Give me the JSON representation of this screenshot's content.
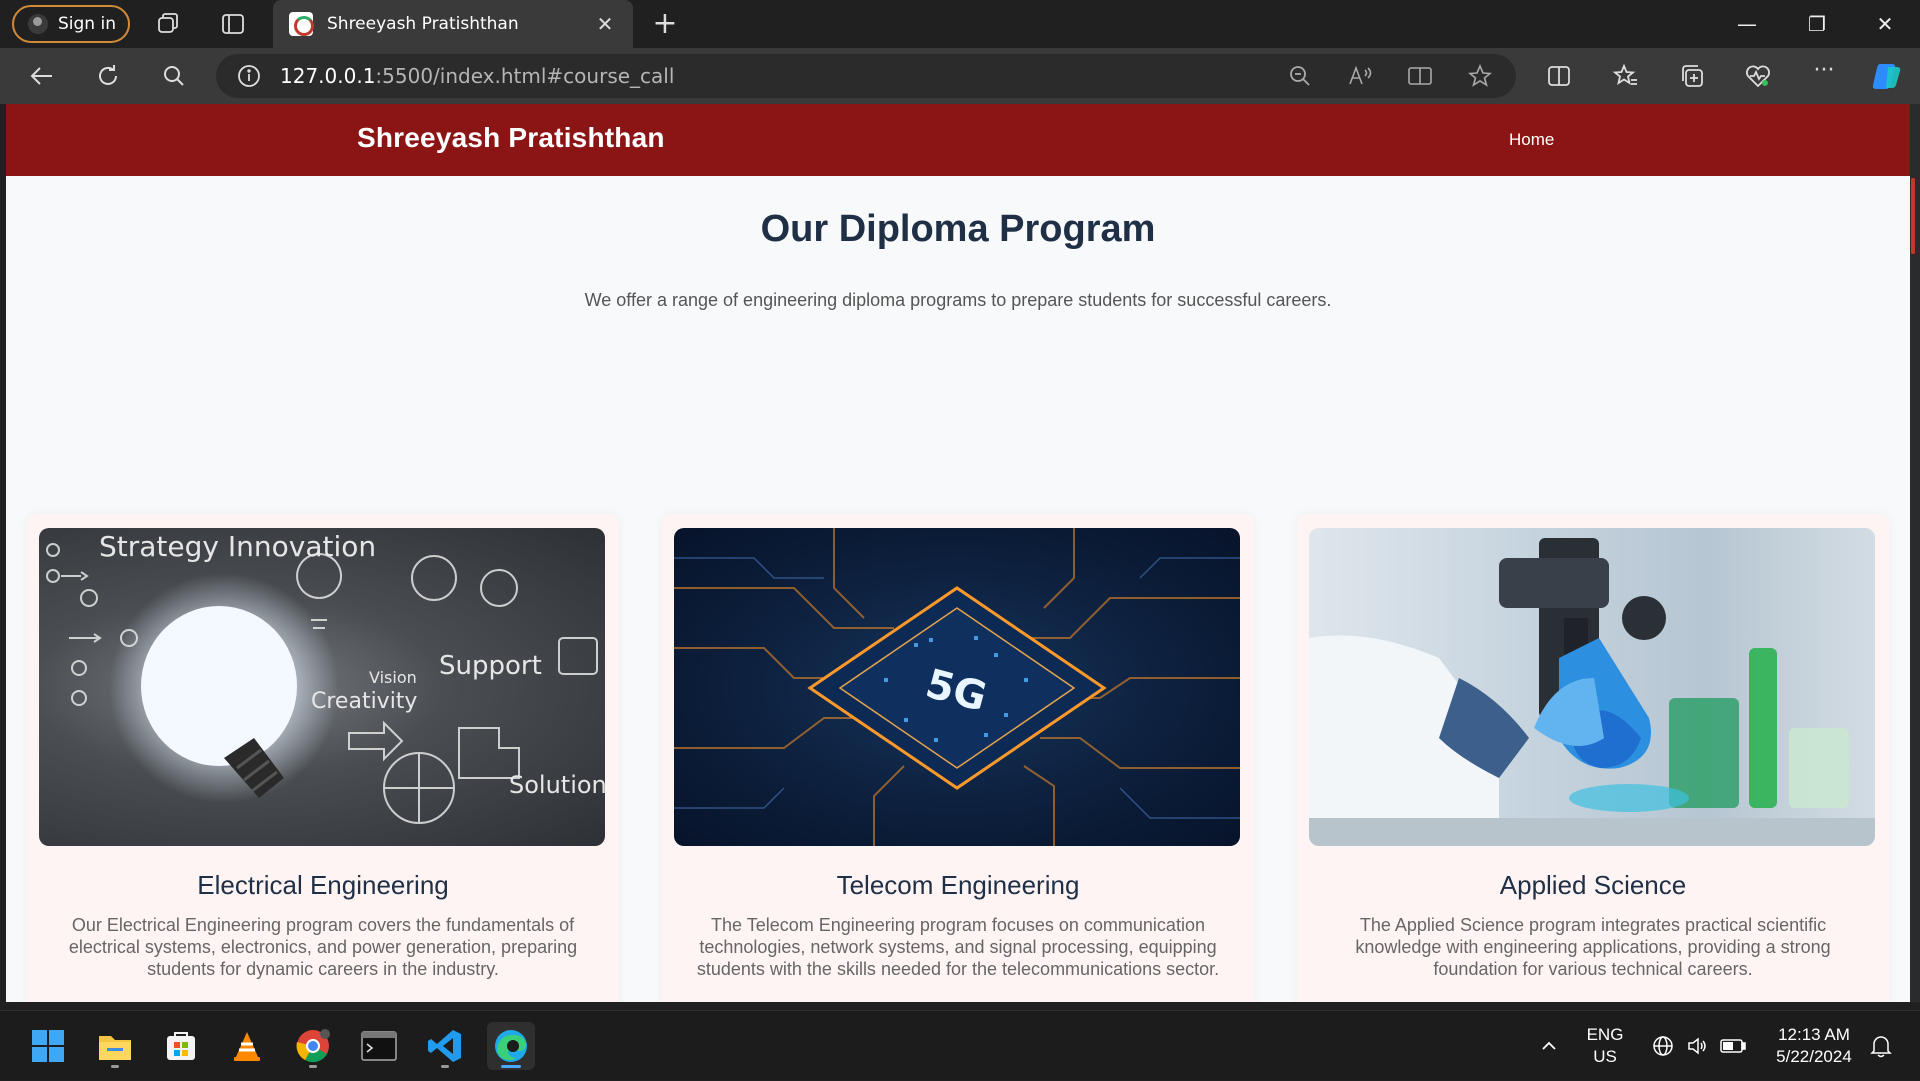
{
  "browser": {
    "signin_label": "Sign in",
    "tab_title": "Shreeyash Pratishthan",
    "url_host": "127.0.0.1",
    "url_rest": ":5500/index.html#course_call"
  },
  "site": {
    "brand": "Shreeyash Pratishthan",
    "nav_home": "Home",
    "title": "Our Diploma Program",
    "subtitle": "We offer a range of engineering diploma programs to prepare students for successful careers.",
    "courses": [
      {
        "title": "Electrical Engineering",
        "description": "Our Electrical Engineering program covers the fundamentals of electrical systems, electronics, and power generation, preparing students for dynamic careers in the industry.",
        "image_words": [
          "Strategy Innovation",
          "Vision",
          "Creativity",
          "Support",
          "Solution"
        ]
      },
      {
        "title": "Telecom Engineering",
        "description": "The Telecom Engineering program focuses on communication technologies, network systems, and signal processing, equipping students with the skills needed for the telecommunications sector.",
        "image_words": [
          "5G"
        ]
      },
      {
        "title": "Applied Science",
        "description": "The Applied Science program integrates practical scientific knowledge with engineering applications, providing a strong foundation for various technical careers."
      }
    ]
  },
  "taskbar": {
    "lang_top": "ENG",
    "lang_bottom": "US",
    "time": "12:13 AM",
    "date": "5/22/2024"
  },
  "colors": {
    "brand_red": "#8b1515",
    "heading": "#1f2f45",
    "card_bg": "#fff4f4",
    "signin_border": "#d08a3a"
  }
}
